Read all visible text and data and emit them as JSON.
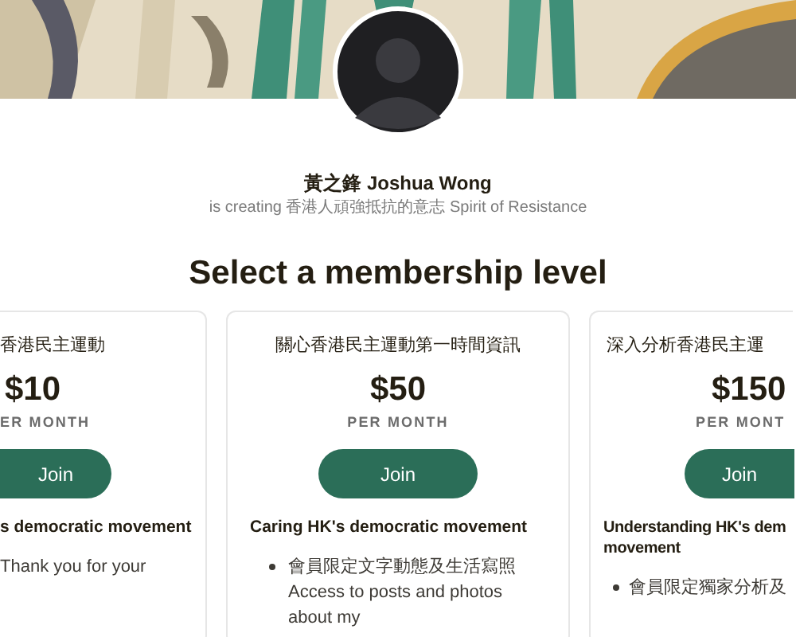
{
  "creator": {
    "name": "黃之鋒 Joshua Wong",
    "tagline": "is creating 香港人頑強抵抗的意志 Spirit of Resistance"
  },
  "heading": "Select a membership level",
  "tiers": [
    {
      "kind": "cut-left",
      "title": "香港民主運動",
      "price": "$10",
      "period": "ER MONTH",
      "button": "Join",
      "subtitle": [
        "s democratic movement"
      ],
      "benefits": [
        {
          "kind": "plain",
          "text": "Thank you for your"
        }
      ]
    },
    {
      "kind": "full",
      "title": "關心香港民主運動第一時間資訊",
      "price": "$50",
      "period": "PER MONTH",
      "button": "Join",
      "subtitle": [
        "Caring HK's democratic movement"
      ],
      "benefits": [
        {
          "kind": "bullet",
          "text": "會員限定文字動態及生活寫照 Access to posts and photos about my"
        }
      ]
    },
    {
      "kind": "cut-right",
      "title": "深入分析香港民主運",
      "price": "$150",
      "period": "PER MONT",
      "button": "Join",
      "subtitle": [
        "Understanding HK's dem",
        "movement"
      ],
      "benefits": [
        {
          "kind": "bullet",
          "text": "會員限定獨家分析及"
        }
      ]
    }
  ]
}
